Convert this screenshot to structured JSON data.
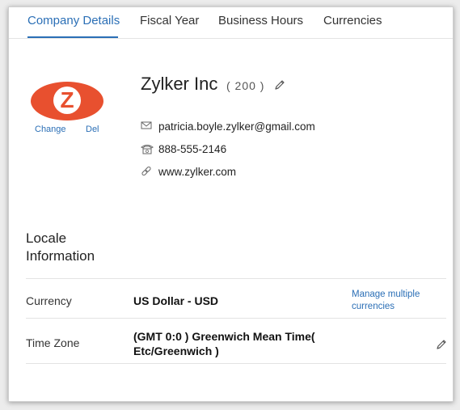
{
  "tabs": [
    {
      "label": "Company Details",
      "active": true
    },
    {
      "label": "Fiscal Year",
      "active": false
    },
    {
      "label": "Business Hours",
      "active": false
    },
    {
      "label": "Currencies",
      "active": false
    }
  ],
  "logo": {
    "letter": "Z",
    "change_label": "Change",
    "delete_label": "Del",
    "brand_color": "#e8502f"
  },
  "company": {
    "name": "Zylker Inc",
    "count": "( 200 )",
    "email": "patricia.boyle.zylker@gmail.com",
    "phone": "888-555-2146",
    "website": "www.zylker.com"
  },
  "locale": {
    "title": "Locale Information",
    "currency_label": "Currency",
    "currency_value": "US Dollar - USD",
    "manage_link": "Manage multiple currencies",
    "timezone_label": "Time Zone",
    "timezone_value": "(GMT 0:0 ) Greenwich Mean Time( Etc/Greenwich )"
  },
  "colors": {
    "accent": "#2b6fb6"
  },
  "icons": {
    "email": "envelope-icon",
    "phone": "telephone-icon",
    "website": "link-icon",
    "edit": "pencil-icon"
  }
}
